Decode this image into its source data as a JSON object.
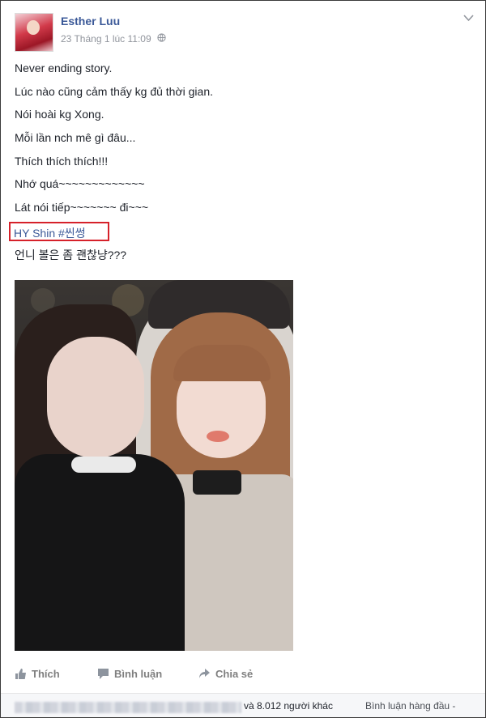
{
  "post": {
    "author": "Esther Luu",
    "timestamp": "23 Tháng 1 lúc 11:09",
    "audience_icon": "globe-icon",
    "menu_icon": "chevron-down-icon",
    "lines": [
      "Never ending story.",
      "Lúc nào cũng cảm thấy kg đủ thời gian.",
      "Nói hoài kg Xong.",
      "Mỗi lần nch mê gì đâu...",
      "Thích thích thích!!!",
      "Nhớ quá~~~~~~~~~~~~~",
      "Lát nói tiếp~~~~~~~ đi~~~"
    ],
    "hashtag_line": "HY Shin #씬썽",
    "korean_line": "언니 볼은 좀 괜찮냥???",
    "highlight_color": "#d6212a",
    "link_color": "#3b5998"
  },
  "actions": {
    "like_label": "Thích",
    "comment_label": "Bình luận",
    "share_label": "Chia sẻ"
  },
  "footer": {
    "others_text": "và 8.012 người khác",
    "top_comments_label": "Bình luận hàng đầu -"
  }
}
